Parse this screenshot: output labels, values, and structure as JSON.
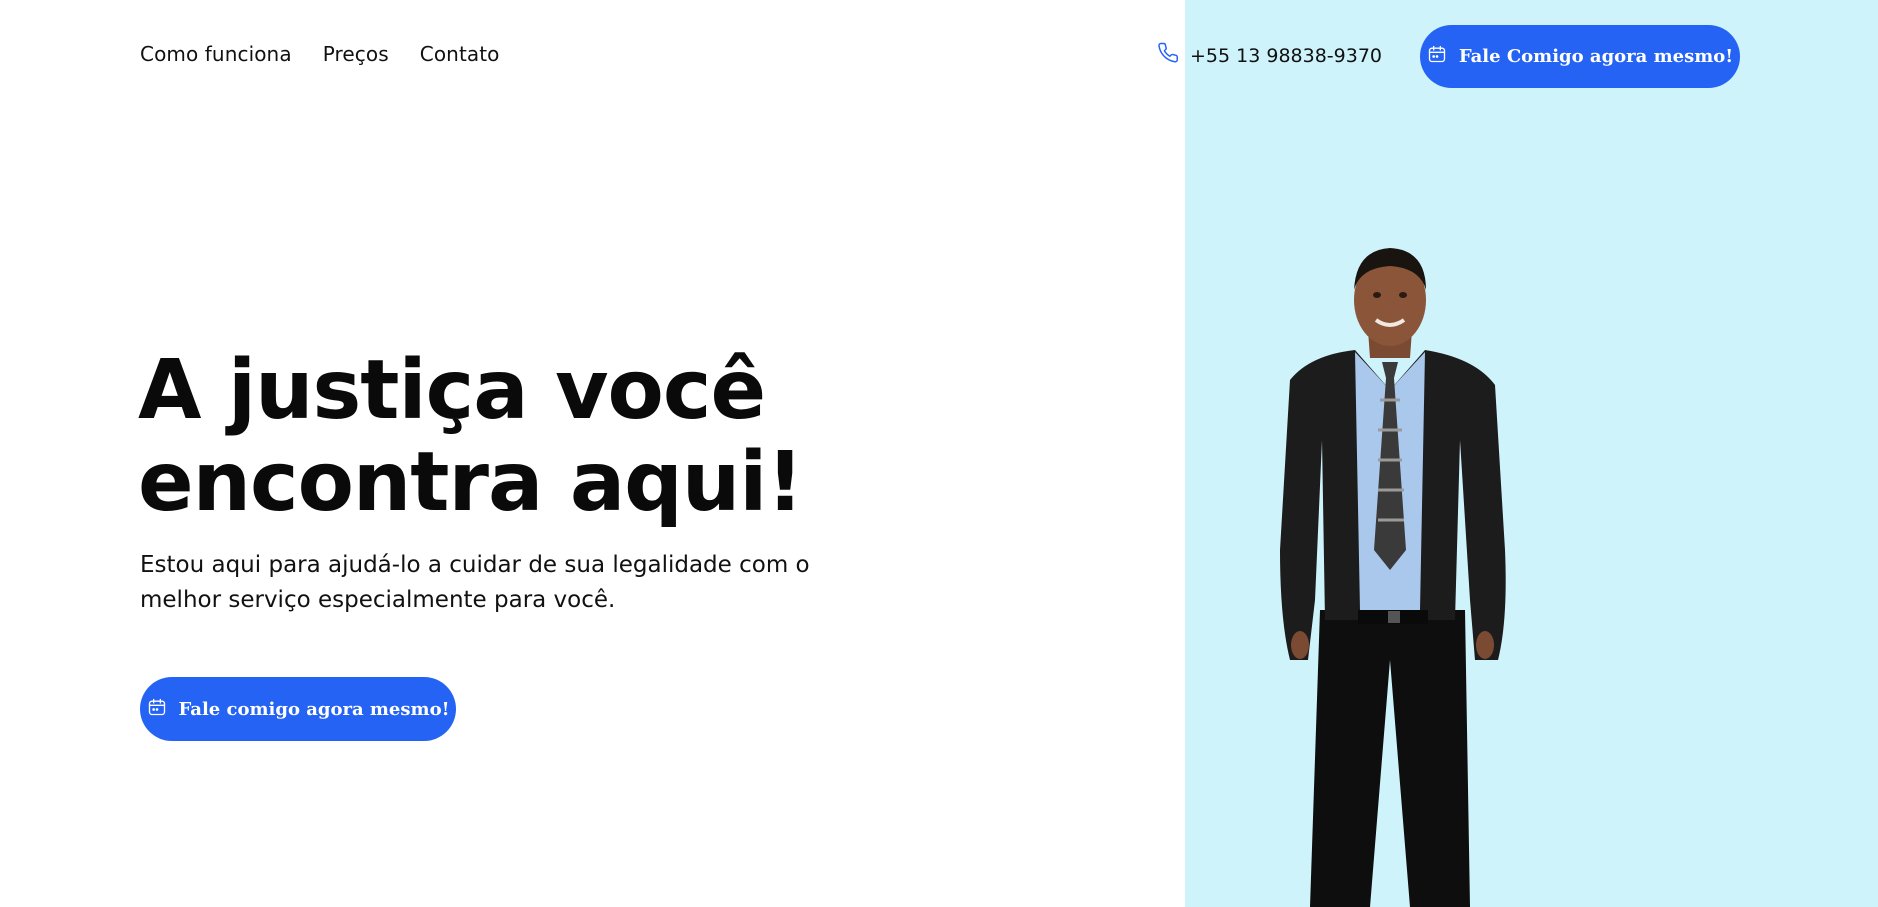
{
  "nav": {
    "items": [
      "Como funciona",
      "Preços",
      "Contato"
    ]
  },
  "header": {
    "phone": "+55 13 98838-9370",
    "cta_label": "Fale Comigo agora mesmo!"
  },
  "hero": {
    "title_line1": "A justiça você",
    "title_line2": "encontra aqui!",
    "subtitle_line1": "Estou aqui para ajudá-lo a cuidar de sua legalidade com o",
    "subtitle_line2": "melhor serviço especialmente para você.",
    "cta_label": "Fale comigo agora mesmo!"
  },
  "colors": {
    "accent": "#2563f5",
    "right_panel_bg": "#cff3fb",
    "text": "#0a0a0a"
  },
  "icons": {
    "phone": "phone-icon",
    "calendar": "calendar-icon"
  }
}
